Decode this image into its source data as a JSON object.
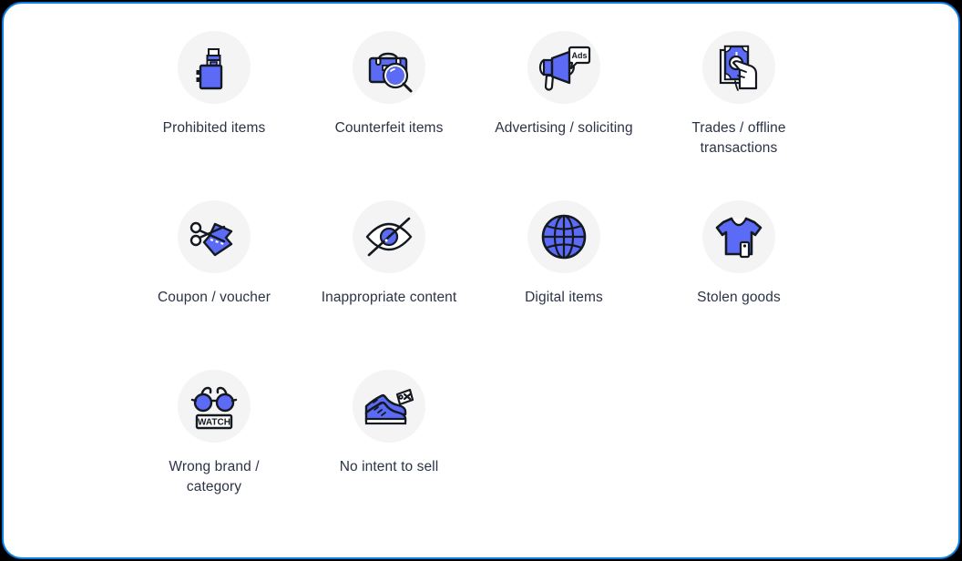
{
  "theme": {
    "accent_blue": "#5c6bf5",
    "outline_dark": "#14181f",
    "circle_bg": "#f4f4f4",
    "label_color": "#2b3346",
    "frame_border": "#0d7fe0",
    "page_bg": "#000000",
    "panel_bg": "#ffffff"
  },
  "grid": {
    "columns": 4,
    "tiles": [
      {
        "id": "prohibited-items",
        "label": "Prohibited items",
        "icon": "vape-device-icon"
      },
      {
        "id": "counterfeit-items",
        "label": "Counterfeit items",
        "icon": "handbag-magnifier-icon"
      },
      {
        "id": "advertising-soliciting",
        "label": "Advertising / soliciting",
        "icon": "megaphone-ads-icon",
        "icon_text": "Ads"
      },
      {
        "id": "trades-offline",
        "label": "Trades / offline transactions",
        "icon": "hand-cash-icon"
      },
      {
        "id": "coupon-voucher",
        "label": "Coupon / voucher",
        "icon": "scissors-coupon-icon"
      },
      {
        "id": "inappropriate-content",
        "label": "Inappropriate content",
        "icon": "eye-slash-icon"
      },
      {
        "id": "digital-items",
        "label": "Digital items",
        "icon": "globe-icon"
      },
      {
        "id": "stolen-goods",
        "label": "Stolen goods",
        "icon": "tshirt-tag-icon"
      },
      {
        "id": "wrong-brand-category",
        "label": "Wrong brand / category",
        "icon": "sunglasses-watch-icon",
        "icon_text": "WATCH"
      },
      {
        "id": "no-intent-to-sell",
        "label": "No intent to sell",
        "icon": "sneakers-tag-x-icon"
      }
    ]
  }
}
